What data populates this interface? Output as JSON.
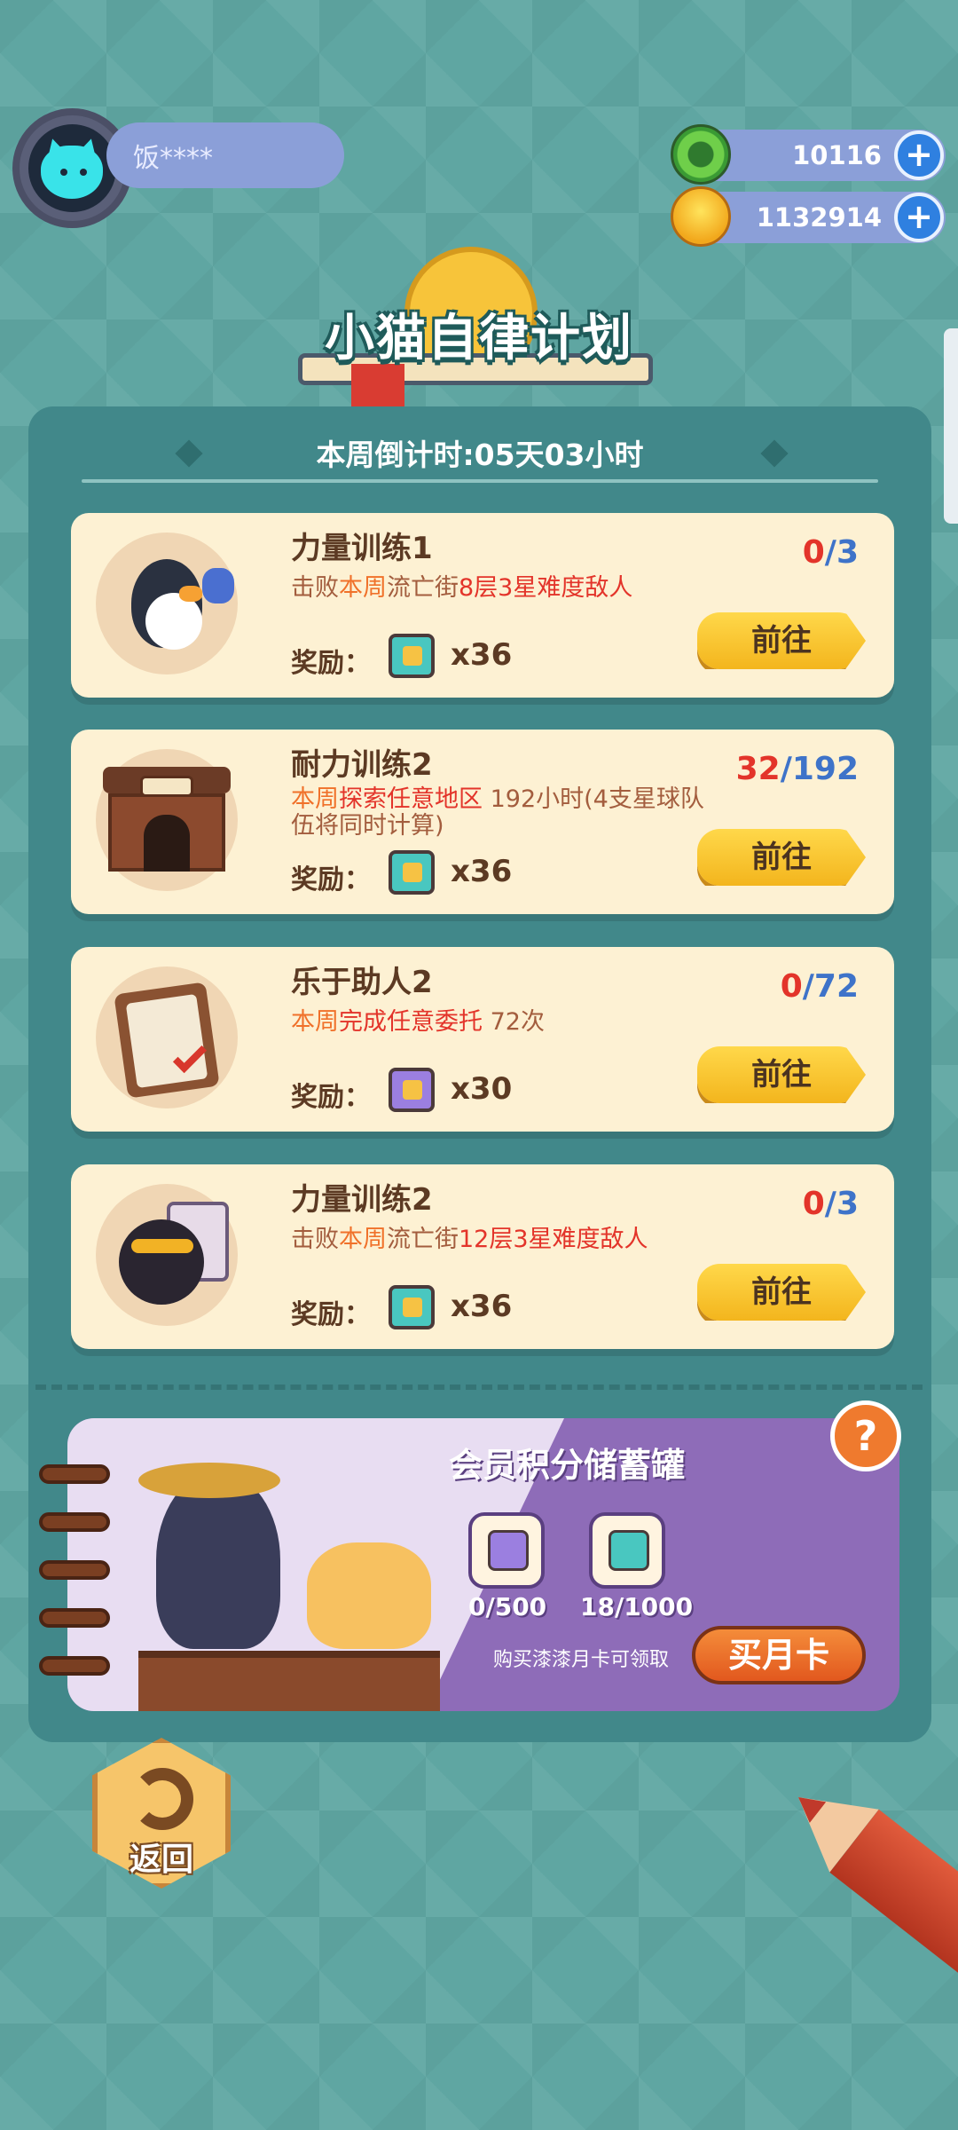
{
  "profile": {
    "name": "饭****"
  },
  "currencies": [
    {
      "icon": "green-donut-currency-icon",
      "value": "10116"
    },
    {
      "icon": "gold-coin-currency-icon",
      "value": "1132914"
    }
  ],
  "title": "小猫自律计划",
  "countdown": "本周倒计时:05天03小时",
  "reward_label": "奖励：",
  "go_label": "前往",
  "tasks": [
    {
      "name": "力量训练1",
      "desc_parts": [
        "击败",
        "本周",
        "流亡街",
        "8层3星难度敌人"
      ],
      "progress_current": "0",
      "progress_total": "/3",
      "reward_icon": "teal-ticket-icon",
      "reward_qty": "x36"
    },
    {
      "name": "耐力训练2",
      "desc_parts": [
        "本周",
        "探索任意地区",
        " 192小时(4支星球队伍将同时计算)"
      ],
      "progress_current": "32",
      "progress_total": "/192",
      "reward_icon": "teal-ticket-icon",
      "reward_qty": "x36"
    },
    {
      "name": "乐于助人2",
      "desc_parts": [
        "本周",
        "完成任意委托",
        " 72次"
      ],
      "progress_current": "0",
      "progress_total": "/72",
      "reward_icon": "purple-ticket-icon",
      "reward_qty": "x30"
    },
    {
      "name": "力量训练2",
      "desc_parts": [
        "击败",
        "本周",
        "流亡街",
        "12层3星难度敌人"
      ],
      "progress_current": "0",
      "progress_total": "/3",
      "reward_icon": "teal-ticket-icon",
      "reward_qty": "x36"
    }
  ],
  "member": {
    "title": "会员积分储蓄罐",
    "items": [
      {
        "icon": "purple-ticket-icon",
        "value": "0/500"
      },
      {
        "icon": "teal-ticket-icon",
        "value": "18/1000"
      }
    ],
    "note": "购买漆漆月卡可领取",
    "buy_label": "买月卡",
    "help_label": "?"
  },
  "back_label": "返回",
  "plus_label": "+"
}
